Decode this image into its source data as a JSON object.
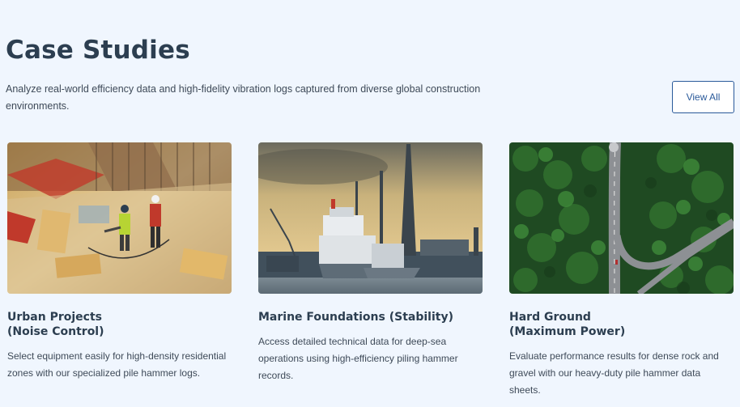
{
  "section": {
    "title": "Case Studies",
    "description": "Analyze real-world efficiency data and high-fidelity vibration logs captured from diverse global construction environments.",
    "view_all_label": "View All"
  },
  "cards": [
    {
      "title_line1": "Urban Projects",
      "title_line2": "(Noise Control)",
      "text": "Select equipment easily for high-density residential zones with our specialized pile hammer logs.",
      "image": "construction-site-photo"
    },
    {
      "title_line1": "Marine Foundations (Stability)",
      "title_line2": "",
      "text": "Access detailed technical data for deep-sea operations using high-efficiency piling hammer records.",
      "image": "harbor-cranes-photo"
    },
    {
      "title_line1": "Hard Ground",
      "title_line2": "(Maximum Power)",
      "text": "Evaluate performance results for dense rock and gravel with our heavy-duty pile hammer data sheets.",
      "image": "forest-road-aerial-photo"
    }
  ]
}
